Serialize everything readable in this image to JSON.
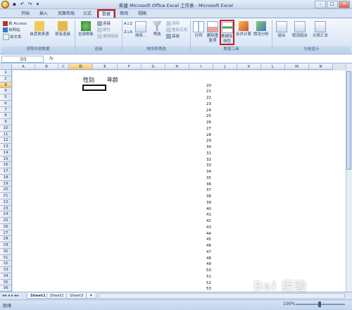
{
  "window": {
    "title": "新建 Microsoft Office Excel 工作表 - Microsoft Excel",
    "buttons": [
      "minimize",
      "maximize",
      "close"
    ]
  },
  "tabs": [
    "开始",
    "插入",
    "页面布局",
    "公式",
    "数据",
    "审阅",
    "视图"
  ],
  "active_tab": "数据",
  "ribbon": {
    "external": {
      "label": "获取外部数据",
      "items": [
        "自 Access",
        "自网站",
        "自文本",
        "自其他来源",
        "现有连接"
      ]
    },
    "connections": {
      "label": "连接",
      "refresh": "全部刷新",
      "items": [
        "连接",
        "属性",
        "编辑链接"
      ]
    },
    "sort": {
      "label": "排序和筛选",
      "sort_az": "A↓Z",
      "sort_za": "Z↓A",
      "sort": "排序...",
      "filter": "筛选",
      "items": [
        "清除",
        "重新应用",
        "高级"
      ]
    },
    "tools": {
      "label": "数据工具",
      "split": "分列",
      "remove_dup": "删除重复项",
      "validation": "数据有效性",
      "consolidate": "合并计算",
      "whatif": "假设分析"
    },
    "outline": {
      "label": "分级显示",
      "group": "组合",
      "ungroup": "取消组合",
      "subtotal": "分类汇总"
    }
  },
  "formula_bar": {
    "name_box": "D3",
    "fx": "fx",
    "value": ""
  },
  "columns": [
    "A",
    "B",
    "C",
    "D",
    "E",
    "F",
    "G",
    "H",
    "I",
    "J",
    "K",
    "L",
    "M",
    "N"
  ],
  "selected_column": "D",
  "rows": [
    1,
    2,
    3,
    4,
    5,
    6,
    7,
    8,
    9,
    10,
    11,
    12,
    13,
    14,
    15,
    16,
    17,
    18,
    19,
    20,
    21,
    22,
    23,
    24,
    25,
    26,
    27,
    28,
    29,
    30,
    31,
    32,
    33,
    34,
    35,
    36
  ],
  "selected_row": 3,
  "cells": {
    "D2": "性别",
    "E2": "年龄",
    "I_values": [
      20,
      21,
      22,
      23,
      24,
      25,
      26,
      27,
      28,
      29,
      30,
      31,
      32,
      33,
      34,
      35,
      36,
      37,
      38,
      39,
      40,
      41,
      42,
      43,
      44,
      45,
      46,
      47,
      48,
      49,
      50,
      51,
      52,
      53
    ]
  },
  "sheets": [
    "Sheet1",
    "Sheet2",
    "Sheet3"
  ],
  "active_sheet": "Sheet1",
  "status": {
    "mode": "就绪",
    "zoom": "100%"
  },
  "watermark": "Bai 经验"
}
